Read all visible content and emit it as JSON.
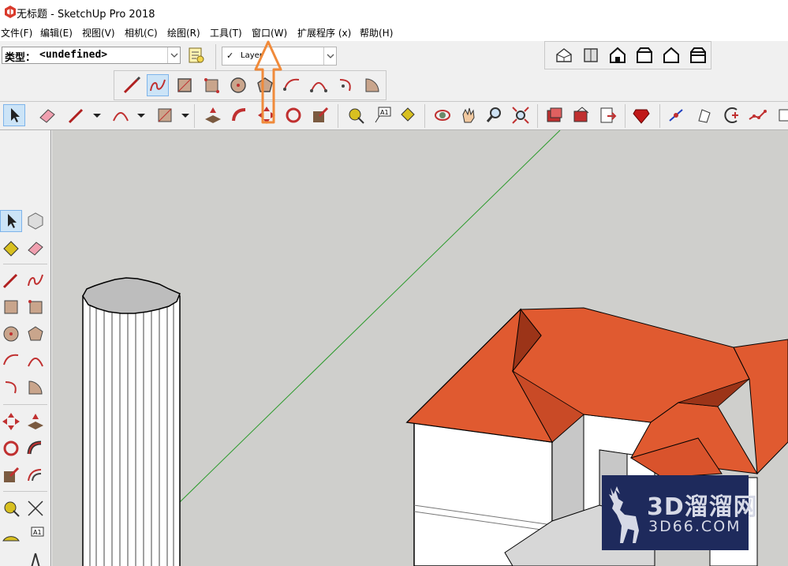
{
  "window": {
    "title": "无标题 - SketchUp Pro 2018"
  },
  "menu": [
    "文件(F)",
    "编辑(E)",
    "视图(V)",
    "相机(C)",
    "绘图(R)",
    "工具(T)",
    "窗口(W)",
    "扩展程序 (x)",
    "帮助(H)"
  ],
  "entity_info": {
    "label": "类型：",
    "value": "<undefined>"
  },
  "layers": {
    "check": "✓",
    "name": "Layer"
  },
  "watermark": {
    "main": "3D溜溜网",
    "sub": "3D66.COM"
  },
  "annotation": {
    "color": "#f08a3a",
    "target": "窗口(W)"
  },
  "colors": {
    "axis_green": "#2a9a2a",
    "roof": "#e05a30",
    "roof_dark": "#9c3418",
    "wall": "#ffffff",
    "viewport_bg": "#cfcfcc"
  },
  "toolbar_icons": {
    "views": [
      "iso-view-icon",
      "top-view-icon",
      "front-view-icon",
      "right-view-icon",
      "back-view-icon",
      "left-view-icon"
    ],
    "drawing": [
      "line-icon",
      "freehand-icon",
      "rectangle-icon",
      "rotated-rectangle-icon",
      "circle-icon",
      "polygon-icon",
      "arc-icon",
      "2point-arc-icon",
      "3point-arc-icon",
      "pie-icon"
    ],
    "main": [
      "select-icon",
      "eraser-icon",
      "pencil-icon",
      "arc-tool-icon",
      "shape-tool-icon",
      "push-pull-icon",
      "follow-me-icon",
      "move-icon",
      "rotate-icon",
      "scale-icon",
      "tape-measure-icon",
      "text-icon",
      "paint-bucket-icon",
      "orbit-icon",
      "pan-icon",
      "zoom-icon",
      "zoom-extents-icon",
      "warehouse-icon",
      "extension-warehouse-icon",
      "send-to-layout-icon",
      "ruby-console-icon",
      "sandbox-icon",
      "geo-location-icon",
      "arc-add-icon",
      "polyline-icon"
    ]
  }
}
